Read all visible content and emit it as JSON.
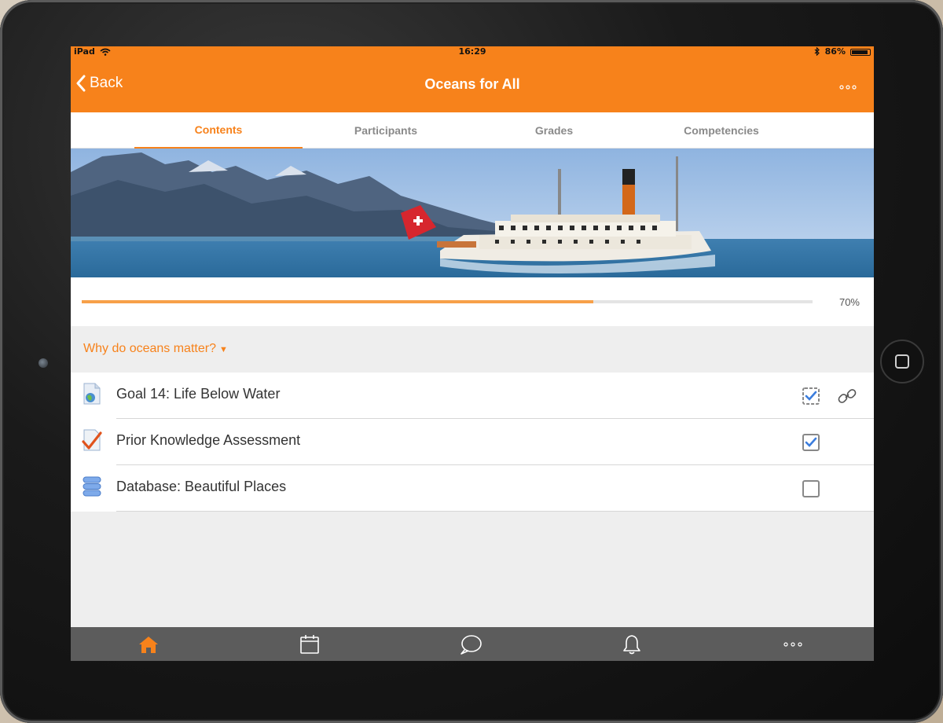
{
  "status_bar": {
    "device": "iPad",
    "time": "16:29",
    "battery": "86%"
  },
  "header": {
    "back_label": "Back",
    "title": "Oceans for All",
    "more_icon": "more-horizontal-icon"
  },
  "tabs": [
    {
      "label": "Contents",
      "active": true
    },
    {
      "label": "Participants",
      "active": false
    },
    {
      "label": "Grades",
      "active": false
    },
    {
      "label": "Competencies",
      "active": false
    }
  ],
  "progress": {
    "value": 0.7,
    "label": "70%"
  },
  "section": {
    "title": "Why do oceans matter?"
  },
  "activities": [
    {
      "label": "Goal 14: Life Below Water",
      "icon": "page-globe-icon",
      "completion": "auto-complete",
      "has_link": true
    },
    {
      "label": "Prior Knowledge Assessment",
      "icon": "quiz-check-icon",
      "completion": "checked",
      "has_link": false
    },
    {
      "label": "Database: Beautiful Places",
      "icon": "database-icon",
      "completion": "unchecked",
      "has_link": false
    }
  ],
  "bottom_nav": [
    {
      "name": "home",
      "icon": "home-icon",
      "active": true
    },
    {
      "name": "calendar",
      "icon": "calendar-icon",
      "active": false
    },
    {
      "name": "messages",
      "icon": "chat-icon",
      "active": false
    },
    {
      "name": "notifications",
      "icon": "bell-icon",
      "active": false
    },
    {
      "name": "more",
      "icon": "more-horizontal-icon",
      "active": false
    }
  ],
  "colors": {
    "accent": "#f7821b",
    "progress": "#f7a049",
    "tabbar": "#5c5c5c"
  }
}
